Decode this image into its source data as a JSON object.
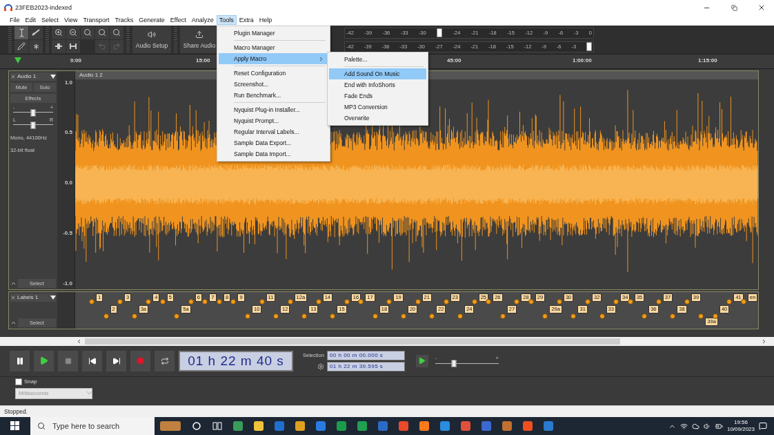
{
  "window": {
    "title": "23FEB2023-indexed"
  },
  "menu_bar": [
    {
      "label": "File",
      "selected": false
    },
    {
      "label": "Edit",
      "selected": false
    },
    {
      "label": "Select",
      "selected": false
    },
    {
      "label": "View",
      "selected": false
    },
    {
      "label": "Transport",
      "selected": false
    },
    {
      "label": "Tracks",
      "selected": false
    },
    {
      "label": "Generate",
      "selected": false
    },
    {
      "label": "Effect",
      "selected": false
    },
    {
      "label": "Analyze",
      "selected": false
    },
    {
      "label": "Tools",
      "selected": true
    },
    {
      "label": "Extra",
      "selected": false
    },
    {
      "label": "Help",
      "selected": false
    }
  ],
  "toolbar": {
    "audio_setup": "Audio Setup",
    "share_audio": "Share Audio"
  },
  "meters": [
    {
      "scale": [
        "-42",
        "-39",
        "-36",
        "-33",
        "-30",
        "-24",
        "-21",
        "-18",
        "-15",
        "-12",
        "-9",
        "-6",
        "-3",
        "0"
      ],
      "level": 0.357
    },
    {
      "scale": [
        "-42",
        "-39",
        "-36",
        "-33",
        "-30",
        "-27",
        "-24",
        "-21",
        "-18",
        "-15",
        "-12",
        "-9",
        "-6",
        "-3"
      ],
      "level": 1
    }
  ],
  "ruler": {
    "ticks": [
      "0:00",
      "15:00",
      "45:00",
      "1:00:00",
      "1:15:00"
    ]
  },
  "audio_track": {
    "name": "Audio 1",
    "mute": "Mute",
    "solo": "Solo",
    "effects": "Effects",
    "gain": {
      "minus": "-",
      "plus": "+",
      "level": 0.5
    },
    "pan": {
      "left": "L",
      "right": "R",
      "level": 0.5
    },
    "format": [
      "Mono, 44100Hz",
      "32-bit float"
    ],
    "select": "Select",
    "clip_title": "Audio 1 2",
    "scale": [
      "1.0",
      "0.5",
      "0.0",
      "-0.5",
      "-1.0"
    ]
  },
  "label_track": {
    "name": "Labels 1",
    "select": "Select",
    "labels": [
      {
        "text": "1",
        "kind": "upper"
      },
      {
        "text": "2",
        "kind": "lower"
      },
      {
        "text": "3",
        "kind": "upper"
      },
      {
        "text": "3a",
        "kind": "lower"
      },
      {
        "text": "4",
        "kind": "upper"
      },
      {
        "text": "5",
        "kind": "upper"
      },
      {
        "text": "5a",
        "kind": "lower"
      },
      {
        "text": "6",
        "kind": "upper"
      },
      {
        "text": "7",
        "kind": "upper"
      },
      {
        "text": "8",
        "kind": "upper"
      },
      {
        "text": "9",
        "kind": "upper"
      },
      {
        "text": "10",
        "kind": "lower"
      },
      {
        "text": "11",
        "kind": "upper"
      },
      {
        "text": "12",
        "kind": "lower"
      },
      {
        "text": "12a",
        "kind": "upper"
      },
      {
        "text": "13",
        "kind": "lower"
      },
      {
        "text": "14",
        "kind": "upper"
      },
      {
        "text": "15",
        "kind": "lower"
      },
      {
        "text": "16",
        "kind": "upper"
      },
      {
        "text": "17",
        "kind": "upper"
      },
      {
        "text": "18",
        "kind": "lower"
      },
      {
        "text": "19",
        "kind": "upper"
      },
      {
        "text": "20",
        "kind": "lower"
      },
      {
        "text": "21",
        "kind": "upper"
      },
      {
        "text": "22",
        "kind": "lower"
      },
      {
        "text": "23",
        "kind": "upper"
      },
      {
        "text": "24",
        "kind": "lower"
      },
      {
        "text": "25",
        "kind": "upper"
      },
      {
        "text": "26",
        "kind": "upper"
      },
      {
        "text": "27",
        "kind": "lower"
      },
      {
        "text": "28",
        "kind": "upper"
      },
      {
        "text": "29",
        "kind": "upper"
      },
      {
        "text": "29a",
        "kind": "lower"
      },
      {
        "text": "30",
        "kind": "upper"
      },
      {
        "text": "31",
        "kind": "lower"
      },
      {
        "text": "32",
        "kind": "upper"
      },
      {
        "text": "33",
        "kind": "lower"
      },
      {
        "text": "34",
        "kind": "upper"
      },
      {
        "text": "35",
        "kind": "upper"
      },
      {
        "text": "36",
        "kind": "lower"
      },
      {
        "text": "37",
        "kind": "upper"
      },
      {
        "text": "38",
        "kind": "lower"
      },
      {
        "text": "39",
        "kind": "upper"
      },
      {
        "text": "39a",
        "kind": "bottom"
      },
      {
        "text": "40",
        "kind": "lower"
      },
      {
        "text": "41",
        "kind": "upper"
      },
      {
        "text": "en",
        "kind": "upper"
      }
    ]
  },
  "transport": {
    "time": "01 h 22 m 40 s",
    "selection_label": "Selection",
    "selection_start": "00 h 00 m 00.000 s",
    "selection_end": "01 h 22 m 39.595 s",
    "speed": {
      "minus": "-",
      "plus": "+",
      "level": 0.3
    }
  },
  "snap": {
    "label": "Snap",
    "checked": false,
    "unit": "Milliseconds"
  },
  "status_bar": "Stopped.",
  "tools_menu": {
    "groups": [
      [
        {
          "label": "Plugin Manager",
          "selected": false,
          "submenu": false
        }
      ],
      [
        {
          "label": "Macro Manager",
          "selected": false,
          "submenu": false
        },
        {
          "label": "Apply Macro",
          "selected": true,
          "submenu": true
        }
      ],
      [
        {
          "label": "Reset Configuration",
          "selected": false,
          "submenu": false
        },
        {
          "label": "Screenshot...",
          "selected": false,
          "submenu": false
        },
        {
          "label": "Run Benchmark...",
          "selected": false,
          "submenu": false
        }
      ],
      [
        {
          "label": "Nyquist Plug-in Installer...",
          "selected": false,
          "submenu": false
        },
        {
          "label": "Nyquist Prompt...",
          "selected": false,
          "submenu": false
        },
        {
          "label": "Regular Interval Labels...",
          "selected": false,
          "submenu": false
        },
        {
          "label": "Sample Data Export...",
          "selected": false,
          "submenu": false
        },
        {
          "label": "Sample Data Import...",
          "selected": false,
          "submenu": false
        }
      ]
    ]
  },
  "apply_macro_menu": {
    "groups": [
      [
        {
          "label": "Palette...",
          "selected": false,
          "submenu": false
        }
      ],
      [
        {
          "label": "Add Sound On Music",
          "selected": true,
          "submenu": false
        },
        {
          "label": "End with InfoShorts",
          "selected": false,
          "submenu": false
        },
        {
          "label": "Fade Ends",
          "selected": false,
          "submenu": false
        },
        {
          "label": "MP3 Conversion",
          "selected": false,
          "submenu": false
        },
        {
          "label": "Overwrite",
          "selected": false,
          "submenu": false
        }
      ]
    ]
  },
  "taskbar": {
    "search_placeholder": "Type here to search",
    "time": "19:56",
    "date": "10/09/2023"
  }
}
